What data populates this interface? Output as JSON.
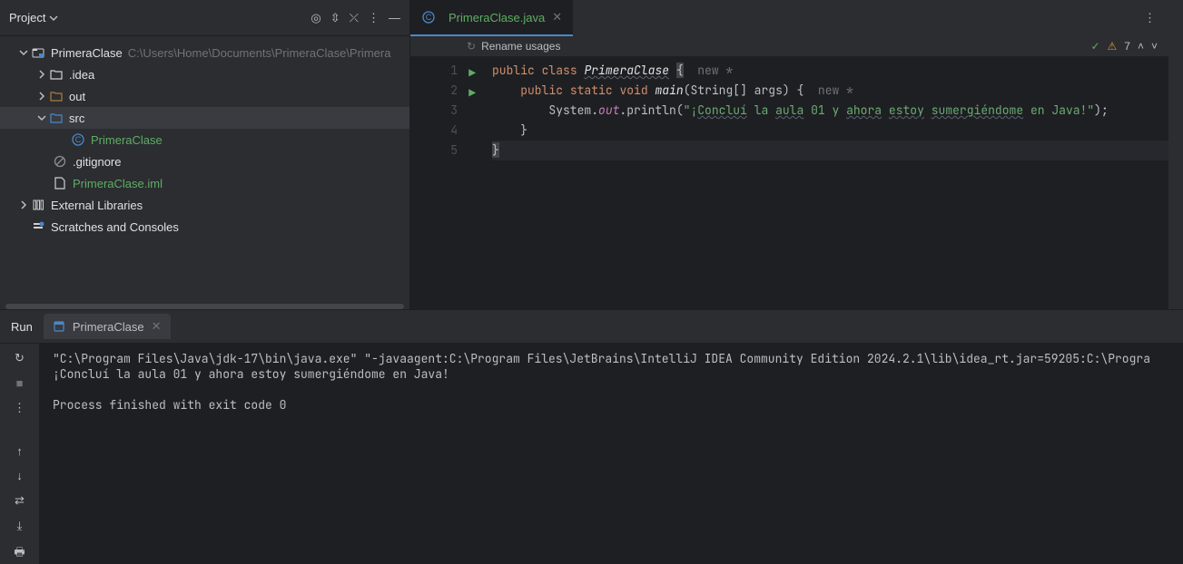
{
  "sidebar": {
    "title": "Project",
    "root": {
      "name": "PrimeraClase",
      "path": "C:\\Users\\Home\\Documents\\PrimeraClase\\Primera"
    },
    "nodes": {
      "idea": ".idea",
      "out": "out",
      "src": "src",
      "file_java": "PrimeraClase",
      "gitignore": ".gitignore",
      "iml": "PrimeraClase.iml",
      "ext_libs": "External Libraries",
      "scratches": "Scratches and Consoles"
    }
  },
  "editor": {
    "tab": "PrimeraClase.java",
    "banner": "Rename usages",
    "checks_count": "7",
    "code": {
      "l1_kw1": "public",
      "l1_kw2": "class",
      "l1_cls": "PrimeraClase",
      "l1_brace": "{",
      "l1_hint": "new *",
      "l2_kw1": "public",
      "l2_kw2": "static",
      "l2_kw3": "void",
      "l2_m": "main",
      "l2_args": "(String[] args) {",
      "l2_hint": "new *",
      "l3_sys": "System.",
      "l3_out": "out",
      "l3_pln": ".println(",
      "l3_q1": "\"",
      "l3_s1": "¡",
      "l3_w1": "Concluí",
      "l3_s2": " la ",
      "l3_w2": "aula",
      "l3_s3": " 01 y ",
      "l3_w3": "ahora",
      "l3_s4": " ",
      "l3_w4": "estoy",
      "l3_s5": " ",
      "l3_w5": "sumergiéndome",
      "l3_s6": " en Java!",
      "l3_q2": "\"",
      "l3_end": ");",
      "l4": "    }",
      "l5": "}"
    }
  },
  "run": {
    "label": "Run",
    "tab": "PrimeraClase",
    "console": {
      "line1": "\"C:\\Program Files\\Java\\jdk-17\\bin\\java.exe\" \"-javaagent:C:\\Program Files\\JetBrains\\IntelliJ IDEA Community Edition 2024.2.1\\lib\\idea_rt.jar=59205:C:\\Progra",
      "line2": "¡Concluí la aula 01 y ahora estoy sumergiéndome en Java!",
      "line3": "Process finished with exit code 0"
    }
  }
}
